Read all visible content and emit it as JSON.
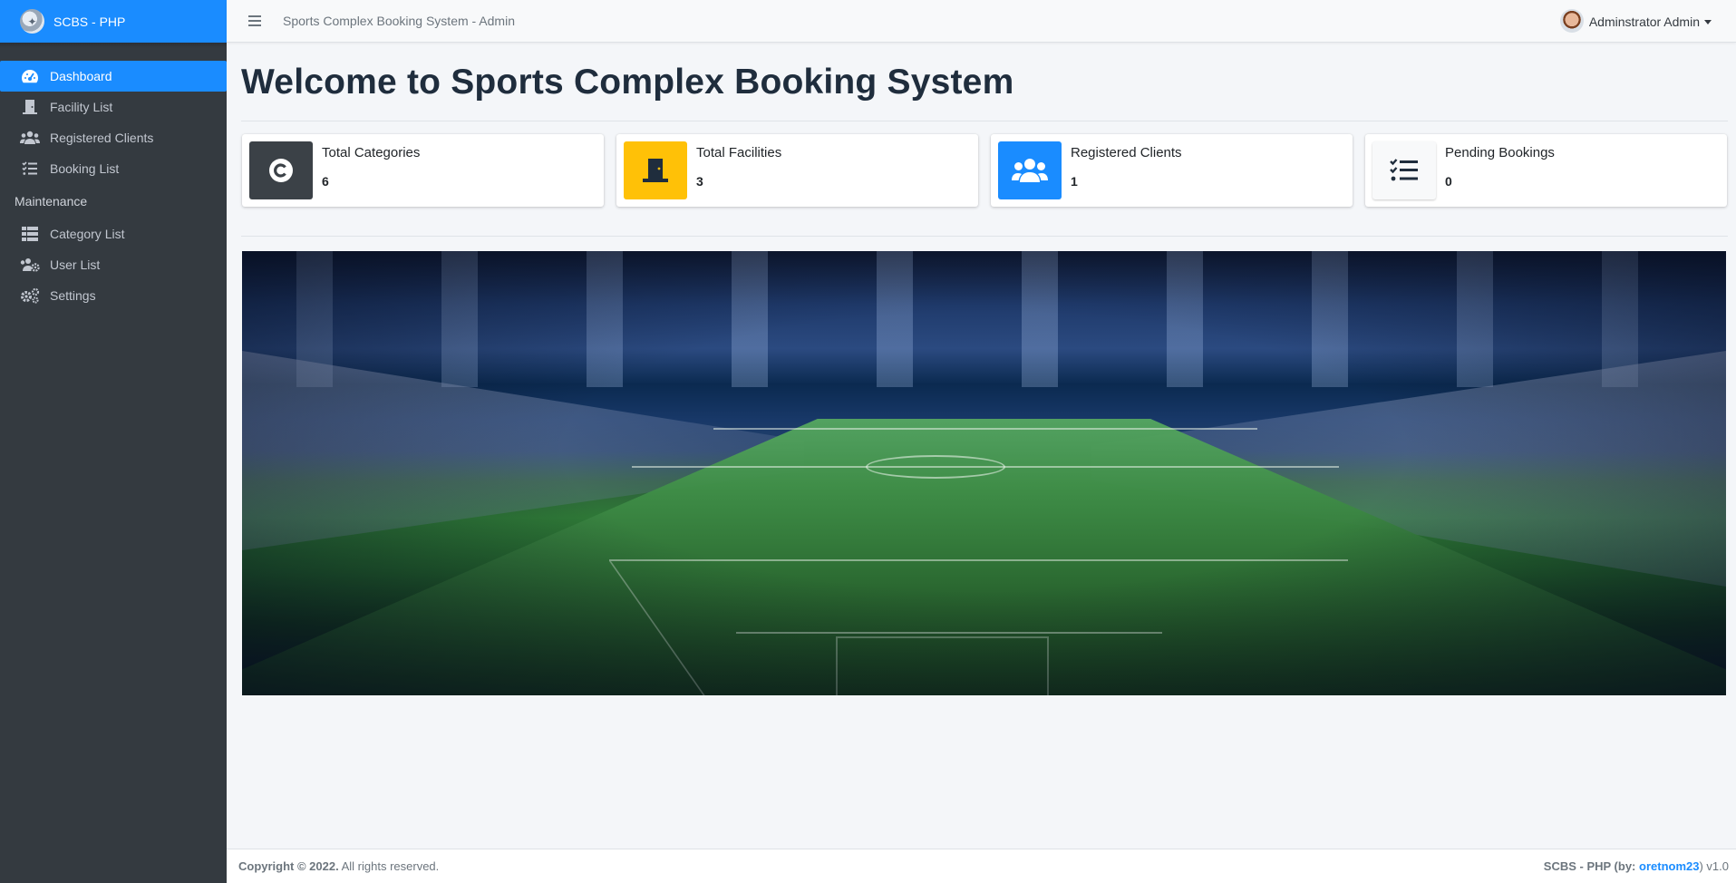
{
  "brand": {
    "name": "SCBS - PHP"
  },
  "topbar": {
    "title": "Sports Complex Booking System - Admin",
    "user_name": "Adminstrator Admin"
  },
  "sidebar": {
    "items": [
      {
        "label": "Dashboard",
        "icon": "dashboard-icon",
        "active": true
      },
      {
        "label": "Facility List",
        "icon": "door-icon"
      },
      {
        "label": "Registered Clients",
        "icon": "users-icon"
      },
      {
        "label": "Booking List",
        "icon": "tasks-icon"
      }
    ],
    "maintenance_header": "Maintenance",
    "maintenance_items": [
      {
        "label": "Category List",
        "icon": "table-list-icon"
      },
      {
        "label": "User List",
        "icon": "users-cog-icon"
      },
      {
        "label": "Settings",
        "icon": "cogs-icon"
      }
    ]
  },
  "main": {
    "page_title": "Welcome to Sports Complex Booking System",
    "cards": [
      {
        "label": "Total Categories",
        "value": "6",
        "icon": "copyright-icon",
        "color": "#343a40"
      },
      {
        "label": "Total Facilities",
        "value": "3",
        "icon": "door-closed-icon",
        "color": "#ffc107"
      },
      {
        "label": "Registered Clients",
        "value": "1",
        "icon": "users-icon",
        "color": "#1a8cff"
      },
      {
        "label": "Pending Bookings",
        "value": "0",
        "icon": "tasks-icon",
        "color": "#f8f9fa"
      }
    ],
    "banner_image": "stadium-banner"
  },
  "footer": {
    "copyright": "Copyright © 2022.",
    "rights": "All rights reserved.",
    "app_credit_prefix": "SCBS - PHP (by:",
    "author": "oretnom23",
    "version_suffix": ") v1.0"
  },
  "colors": {
    "primary": "#1a8cff",
    "sidebar_bg": "#343a40",
    "warning": "#ffc107",
    "dark": "#343a40"
  }
}
